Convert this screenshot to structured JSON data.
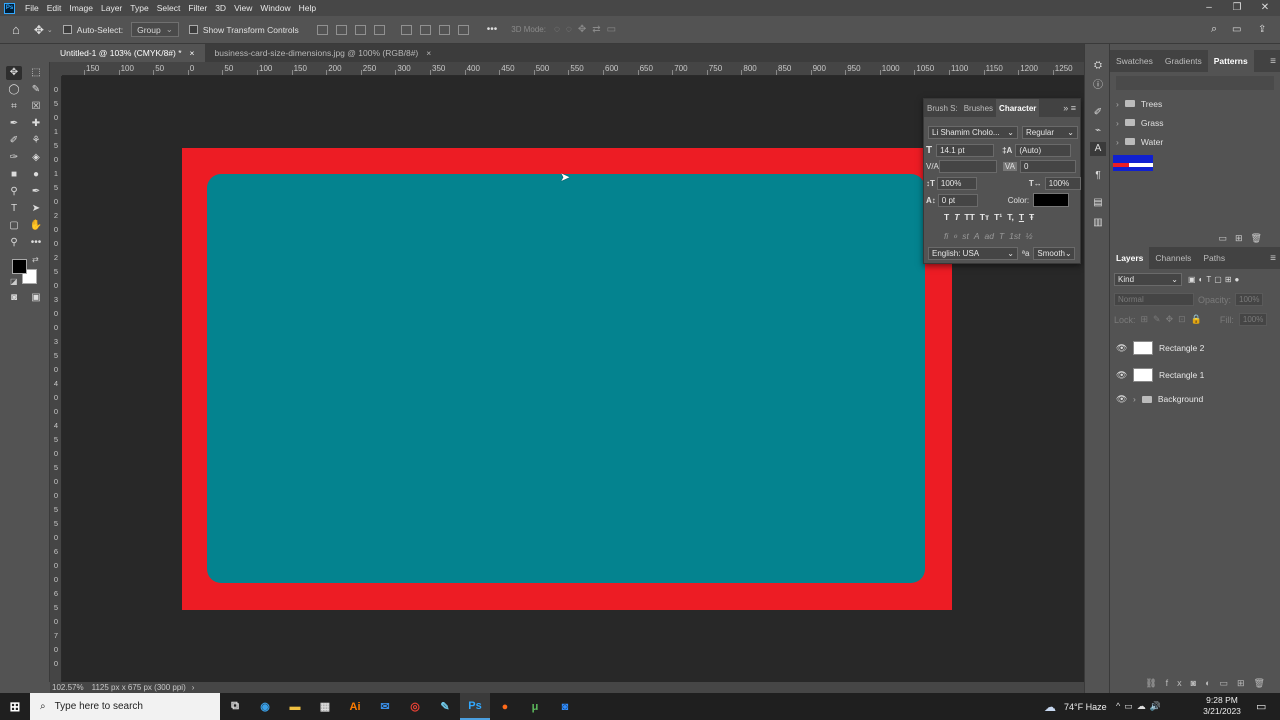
{
  "app": {
    "logo": "Ps"
  },
  "menubar": {
    "items": [
      "File",
      "Edit",
      "Image",
      "Layer",
      "Type",
      "Select",
      "Filter",
      "3D",
      "View",
      "Window",
      "Help"
    ]
  },
  "options": {
    "auto_select_label": "Auto-Select:",
    "group_value": "Group",
    "transform_label": "Show Transform Controls",
    "more": "•••",
    "mode_3d": "3D Mode:"
  },
  "tabs": [
    {
      "label": "Untitled-1 @ 103% (CMYK/8#) *",
      "close": "×"
    },
    {
      "label": "business-card-size-dimensions.jpg @ 100% (RGB/8#)",
      "close": "×"
    }
  ],
  "ruler": {
    "h_labels": [
      "150",
      "100",
      "50",
      "0",
      "50",
      "100",
      "150",
      "200",
      "250",
      "300",
      "350",
      "400",
      "450",
      "500",
      "550",
      "600",
      "650",
      "700",
      "750",
      "800",
      "850",
      "900",
      "950",
      "1000",
      "1050",
      "1100",
      "1150",
      "1200",
      "1250"
    ],
    "v_labels": [
      "0",
      "5",
      "0",
      "1",
      "5",
      "0",
      "1",
      "5",
      "0",
      "2",
      "0",
      "0",
      "2",
      "5",
      "0",
      "3",
      "0",
      "0",
      "3",
      "5",
      "0",
      "4",
      "0",
      "0",
      "4",
      "5",
      "0",
      "5",
      "0",
      "0",
      "5",
      "5",
      "0",
      "6",
      "0",
      "0",
      "6",
      "5",
      "0",
      "7",
      "0",
      "0"
    ]
  },
  "status": {
    "zoom": "102.57%",
    "doc": "1125 px x 675 px (300 ppi)",
    "arrow": "›"
  },
  "character": {
    "tabs": [
      "Brush S:",
      "Brushes",
      "Character"
    ],
    "font": "Li Shamim Cholo...",
    "style": "Regular",
    "size": "14.1 pt",
    "leading": "(Auto)",
    "kerning": "",
    "tracking": "0",
    "vscale": "100%",
    "hscale": "100%",
    "baseline": "0 pt",
    "color_label": "Color:",
    "color": "#000000",
    "language": "English: USA",
    "antialias": "Smooth",
    "glyphs1": [
      "T",
      "T",
      "TT",
      "Tт",
      "T¹",
      "T,",
      "T",
      "Ŧ"
    ],
    "glyphs2": [
      "fi",
      "ℴ",
      "st",
      "A",
      "ad",
      "T",
      "1st",
      "½"
    ]
  },
  "patterns": {
    "tabs": [
      "Swatches",
      "Gradients",
      "Patterns"
    ],
    "folders": [
      "Trees",
      "Grass",
      "Water"
    ]
  },
  "layers": {
    "tabs": [
      "Layers",
      "Channels",
      "Paths"
    ],
    "kind": "Kind",
    "blend": "Normal",
    "opacity_label": "Opacity:",
    "opacity": "100%",
    "lock_label": "Lock:",
    "fill_label": "Fill:",
    "fill": "100%",
    "items": [
      {
        "name": "Rectangle 2",
        "type": "shape"
      },
      {
        "name": "Rectangle 1",
        "type": "shape"
      },
      {
        "name": "Background",
        "type": "group"
      }
    ]
  },
  "canvas": {
    "outer_color": "#ed1c24",
    "inner_color": "#04838f"
  },
  "taskbar": {
    "search_placeholder": "Type here to search",
    "weather": "74°F  Haze",
    "time": "9:28 PM",
    "date": "3/21/2023"
  }
}
